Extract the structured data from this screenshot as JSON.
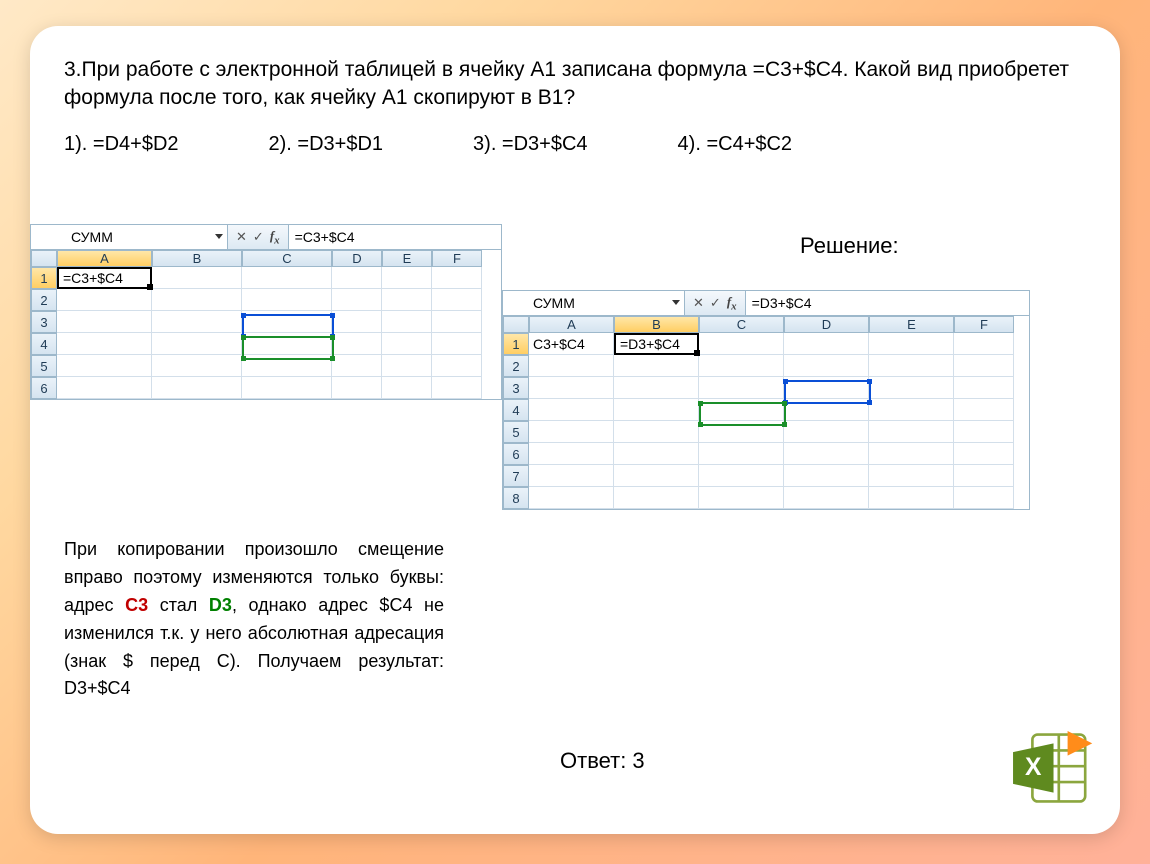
{
  "question": "3.При работе с электронной таблицей в ячейку А1 записана формула =С3+$С4. Какой вид приобретет формула после того, как  ячейку А1 скопируют в В1?",
  "options": {
    "o1": "1). =D4+$D2",
    "o2": "2). =D3+$D1",
    "o3": "3). =D3+$C4",
    "o4": "4). =C4+$C2"
  },
  "solution_label": "Решение:",
  "excel1": {
    "name": "СУММ",
    "formula": "=C3+$C4",
    "cols": [
      "A",
      "B",
      "C",
      "D",
      "E",
      "F"
    ],
    "rows": [
      "1",
      "2",
      "3",
      "4",
      "5",
      "6"
    ],
    "a1": "=C3+$C4"
  },
  "excel2": {
    "name": "СУММ",
    "formula": "=D3+$C4",
    "cols": [
      "A",
      "B",
      "C",
      "D",
      "E",
      "F"
    ],
    "rows": [
      "1",
      "2",
      "3",
      "4",
      "5",
      "6",
      "7",
      "8"
    ],
    "a1": "C3+$C4",
    "b1": "=D3+$C4"
  },
  "explain_parts": {
    "p1": "При копировании произошло смещение вправо поэтому изменяются только буквы: адрес ",
    "c3": "C3",
    "p2": " стал ",
    "d3": "D3",
    "p3": ", однако адрес $С4 не изменился т.к. у него абсолютная адресация (знак $ перед С). Получаем результат: D3+$C4"
  },
  "answer": "Ответ: 3"
}
